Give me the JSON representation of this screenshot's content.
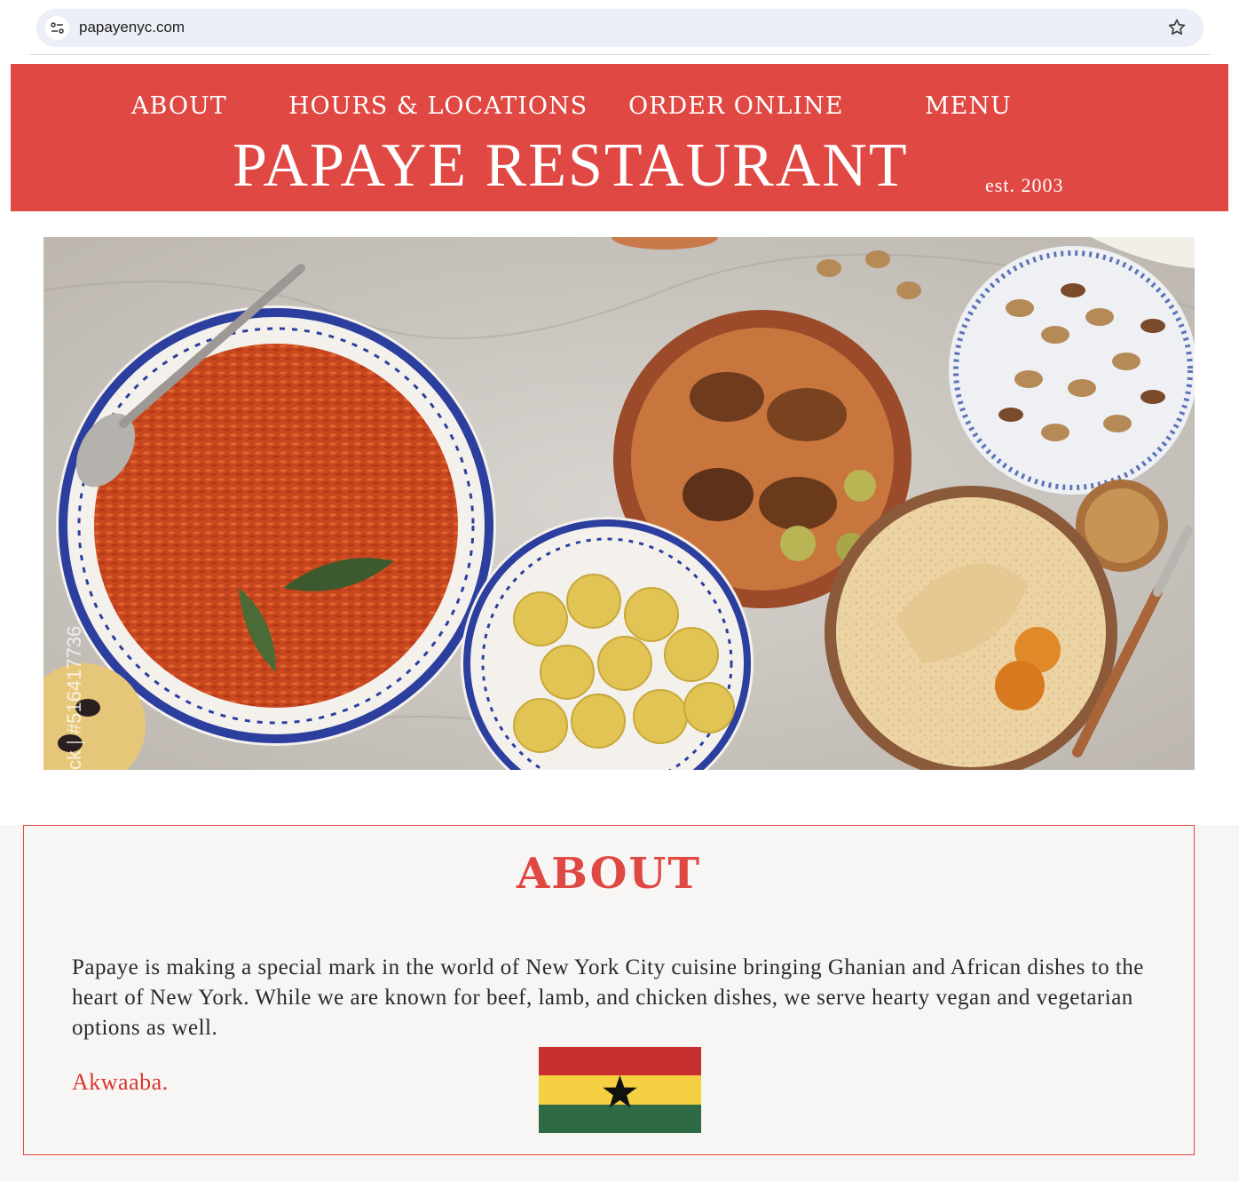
{
  "browser": {
    "url": "papayenyc.com",
    "site_info_icon": "tune-icon",
    "bookmark_icon": "star-outline-icon"
  },
  "header": {
    "nav": [
      {
        "label": "ABOUT"
      },
      {
        "label": "HOURS & LOCATIONS"
      },
      {
        "label": "ORDER ONLINE"
      },
      {
        "label": "MENU"
      }
    ],
    "title": "PAPAYE RESTAURANT",
    "established": "est. 2003",
    "background_color": "#e04843"
  },
  "hero": {
    "image_text": "ck | #516417736"
  },
  "about": {
    "heading": "ABOUT",
    "body": "Papaye is making a special mark in the world of New York City cuisine bringing Ghanian  and African dishes to the heart of New York. While we are known for beef, lamb, and chicken dishes, we serve hearty vegan and vegetarian options as well.",
    "greeting": "Akwaaba.",
    "accent_color": "#e04843",
    "flag_icon": "ghana-flag-icon"
  }
}
